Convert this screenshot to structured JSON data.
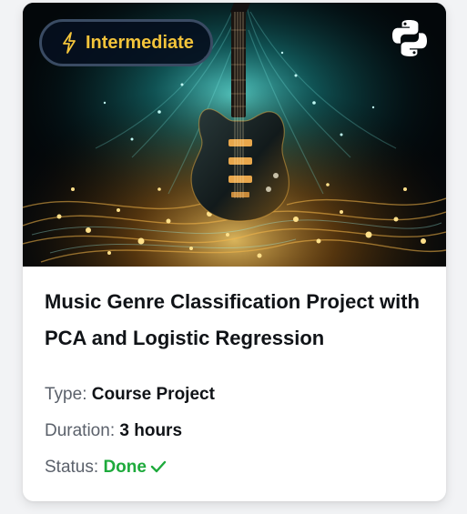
{
  "card": {
    "badge": {
      "label": "Intermediate",
      "icon": "lightning-bolt-icon",
      "color": "#f3c43a"
    },
    "language_icon": "python-logo-icon",
    "title": "Music Genre Classification Project with PCA and Logistic Regression",
    "type": {
      "label": "Type:",
      "value": "Course Project"
    },
    "duration": {
      "label": "Duration:",
      "value": "3 hours"
    },
    "status": {
      "label": "Status:",
      "value": "Done",
      "icon": "checkmark-icon",
      "color": "#1eaa3c"
    }
  }
}
